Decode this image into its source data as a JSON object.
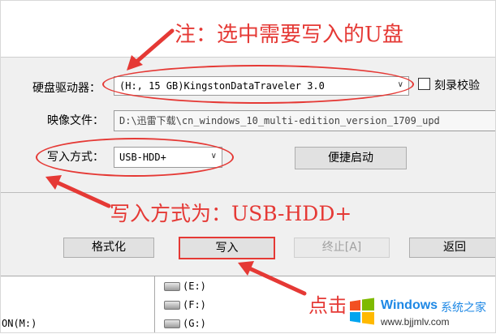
{
  "annotations": {
    "top": "注：选中需要写入的U盘",
    "middle": "写入方式为：USB-HDD+",
    "bottom": "点击"
  },
  "form": {
    "drive_label": "硬盘驱动器：",
    "drive_value": "(H:, 15 GB)KingstonDataTraveler 3.0",
    "verify_checkbox_label": "刻录校验",
    "image_label": "映像文件：",
    "image_path": "D:\\迅雷下载\\cn_windows_10_multi-edition_version_1709_upd",
    "write_mode_label": "写入方式：",
    "write_mode_value": "USB-HDD+",
    "quick_boot_label": "便捷启动"
  },
  "buttons": {
    "format": "格式化",
    "write": "写入",
    "stop": "终止[A]",
    "back": "返回"
  },
  "drives": [
    "(E:)",
    "(F:)",
    "(G:)"
  ],
  "left_tree_fragment": "ON(M:)",
  "watermark": {
    "brand": "Windows",
    "site_name": "系统之家",
    "url": "www.bjjmlv.com"
  },
  "colors": {
    "annotation": "#e53935",
    "panel": "#f0f0f0",
    "windows_blue": "#1e88e5"
  }
}
